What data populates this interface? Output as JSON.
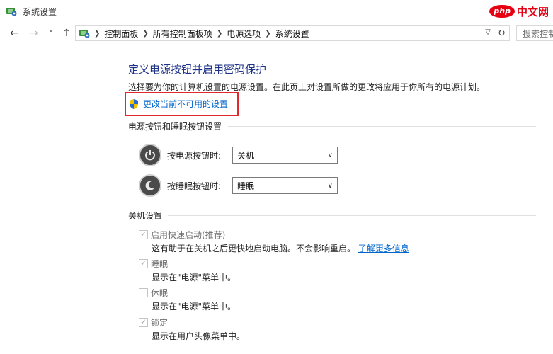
{
  "window": {
    "title": "系统设置"
  },
  "watermark": {
    "logo": "php",
    "text": "中文网"
  },
  "nav": {
    "back": "←",
    "forward": "→",
    "recent": "˅",
    "up": "↑",
    "refresh": "↻",
    "breadcrumbs": [
      "控制面板",
      "所有控制面板项",
      "电源选项",
      "系统设置"
    ],
    "search_placeholder": "搜索控制"
  },
  "content": {
    "heading": "定义电源按钮并启用密码保护",
    "description": "选择要为你的计算机设置的电源设置。在此页上对设置所做的更改将应用于你所有的电源计划。",
    "change_link": "更改当前不可用的设置",
    "power_section": {
      "title": "电源按钮和睡眠按钮设置",
      "power_button_label": "按电源按钮时:",
      "power_button_value": "关机",
      "sleep_button_label": "按睡眠按钮时:",
      "sleep_button_value": "睡眠"
    },
    "shutdown_section": {
      "title": "关机设置",
      "options": [
        {
          "label": "启用快速启动(推荐)",
          "desc": "这有助于在关机之后更快地启动电脑。不会影响重启。",
          "link": "了解更多信息",
          "checked": true
        },
        {
          "label": "睡眠",
          "desc": "显示在\"电源\"菜单中。",
          "checked": true
        },
        {
          "label": "休眠",
          "desc": "显示在\"电源\"菜单中。",
          "checked": false
        },
        {
          "label": "锁定",
          "desc": "显示在用户头像菜单中。",
          "checked": true
        }
      ]
    }
  },
  "icons": [
    "control-panel-icon",
    "shield-icon",
    "power-icon",
    "sleep-icon",
    "check-icon",
    "chevron-down-icon"
  ],
  "colors": {
    "heading": "#1e3287",
    "link": "#0066cc",
    "highlight_border": "#e0282d",
    "watermark": "#e60012"
  }
}
